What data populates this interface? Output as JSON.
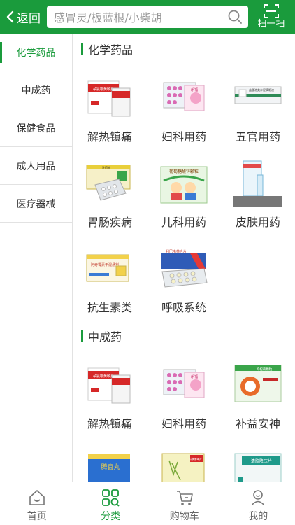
{
  "header": {
    "back_label": "返回",
    "search_placeholder": "感冒灵/板蓝根/小柴胡",
    "scan_label": "扫一扫"
  },
  "sidebar": {
    "items": [
      {
        "label": "化学药品",
        "active": true
      },
      {
        "label": "中成药"
      },
      {
        "label": "保健食品"
      },
      {
        "label": "成人用品"
      },
      {
        "label": "医疗器械"
      }
    ]
  },
  "sections": [
    {
      "title": "化学药品",
      "items": [
        {
          "label": "解热镇痛",
          "pack_text": "孕氨咖黄敏片"
        },
        {
          "label": "妇科用药",
          "pack_text": "乐福"
        },
        {
          "label": "五官用药",
          "pack_text": "盐酸洛美沙星滴眼液"
        },
        {
          "label": "胃肠疾病",
          "pack_text": "注药物"
        },
        {
          "label": "儿科用药",
          "pack_text": "葡萄糖酸锌颗粒"
        },
        {
          "label": "皮肤用药",
          "pack_text": ""
        },
        {
          "label": "抗生素类",
          "pack_text": "阿奇霉素干混悬剂"
        },
        {
          "label": "呼吸系统",
          "pack_text": "利巴韦林含片"
        }
      ]
    },
    {
      "title": "中成药",
      "items": [
        {
          "label": "解热镇痛",
          "pack_text": "孕氨咖黄敏片"
        },
        {
          "label": "妇科用药",
          "pack_text": "乐福"
        },
        {
          "label": "补益安神",
          "pack_text": "枸杞菊颗粒"
        },
        {
          "label": "",
          "pack_text": "腾窗丸"
        },
        {
          "label": "",
          "pack_text": "牛黄解毒片"
        },
        {
          "label": "",
          "pack_text": "清脑降压片"
        }
      ]
    }
  ],
  "tabbar": {
    "items": [
      {
        "label": "首页",
        "icon": "home-icon"
      },
      {
        "label": "分类",
        "icon": "category-icon",
        "active": true
      },
      {
        "label": "购物车",
        "icon": "cart-icon"
      },
      {
        "label": "我的",
        "icon": "profile-icon"
      }
    ]
  },
  "colors": {
    "brand": "#1a9b3c",
    "text": "#333333",
    "placeholder": "#999999"
  }
}
